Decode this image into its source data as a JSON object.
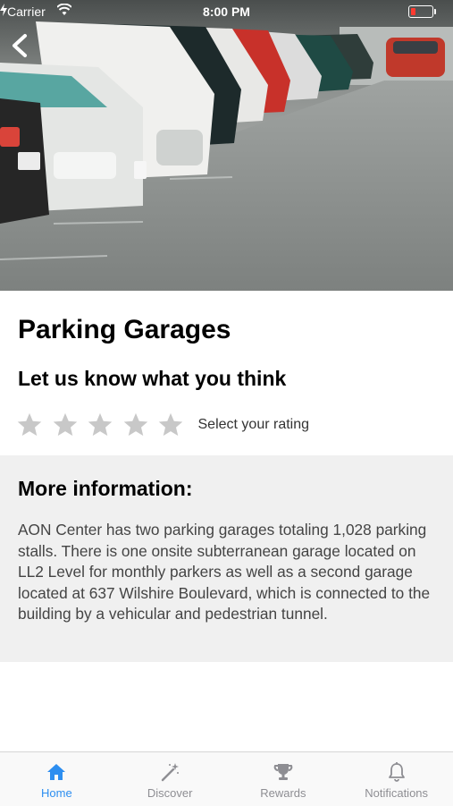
{
  "status_bar": {
    "carrier": "Carrier",
    "time": "8:00 PM"
  },
  "hero": {
    "image": "parking-garage-cars-photo"
  },
  "title": "Parking Garages",
  "feedback": {
    "heading": "Let us know what you think",
    "stars_total": 5,
    "rating_label": "Select your rating"
  },
  "info": {
    "heading": "More information:",
    "body": "AON Center has two parking garages totaling 1,028 parking stalls. There is one onsite subterranean garage located on LL2 Level for monthly parkers as well as a second garage located at 637 Wilshire Boulevard, which is connected to the building by a vehicular and pedestrian tunnel."
  },
  "tabs": [
    {
      "label": "Home",
      "icon": "home-icon",
      "active": true
    },
    {
      "label": "Discover",
      "icon": "magic-wand-icon",
      "active": false
    },
    {
      "label": "Rewards",
      "icon": "trophy-icon",
      "active": false
    },
    {
      "label": "Notifications",
      "icon": "bell-icon",
      "active": false
    }
  ],
  "colors": {
    "accent": "#2d8ef0",
    "star": "#c8c8c8",
    "info_bg": "#f0f0f0"
  }
}
